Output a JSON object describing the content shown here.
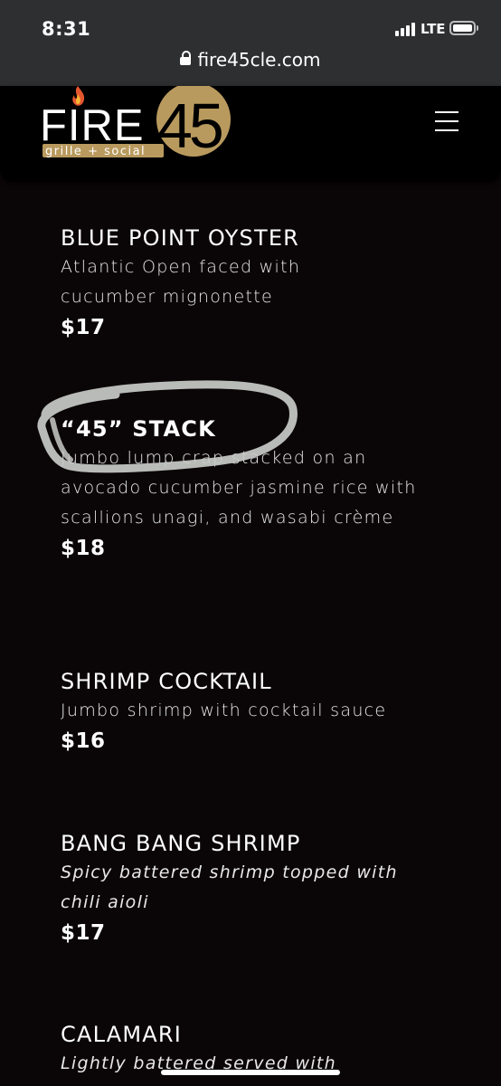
{
  "status_bar": {
    "time": "8:31",
    "network": "LTE"
  },
  "browser": {
    "url": "fire45cle.com"
  },
  "header": {
    "logo_text": "FIRE",
    "logo_number": "45",
    "logo_tagline": "grille + social",
    "accent_color": "#b99a5e"
  },
  "menu": {
    "items": [
      {
        "name": "BLUE POINT OYSTER",
        "description": "Atlantic Open faced with cucumber mignonette",
        "price": "$17"
      },
      {
        "name": "“45” STACK",
        "description": "Jumbo lump crap stacked on an avocado cucumber jasmine rice with scallions unagi, and wasabi crème",
        "price": "$18"
      },
      {
        "name": "SHRIMP COCKTAIL",
        "description": "Jumbo shrimp with cocktail sauce",
        "price": "$16"
      },
      {
        "name": "BANG BANG SHRIMP",
        "description": "Spicy battered shrimp topped with chili aioli",
        "price": "$17"
      },
      {
        "name": "CALAMARI",
        "description": "Lightly battered served with"
      }
    ]
  }
}
